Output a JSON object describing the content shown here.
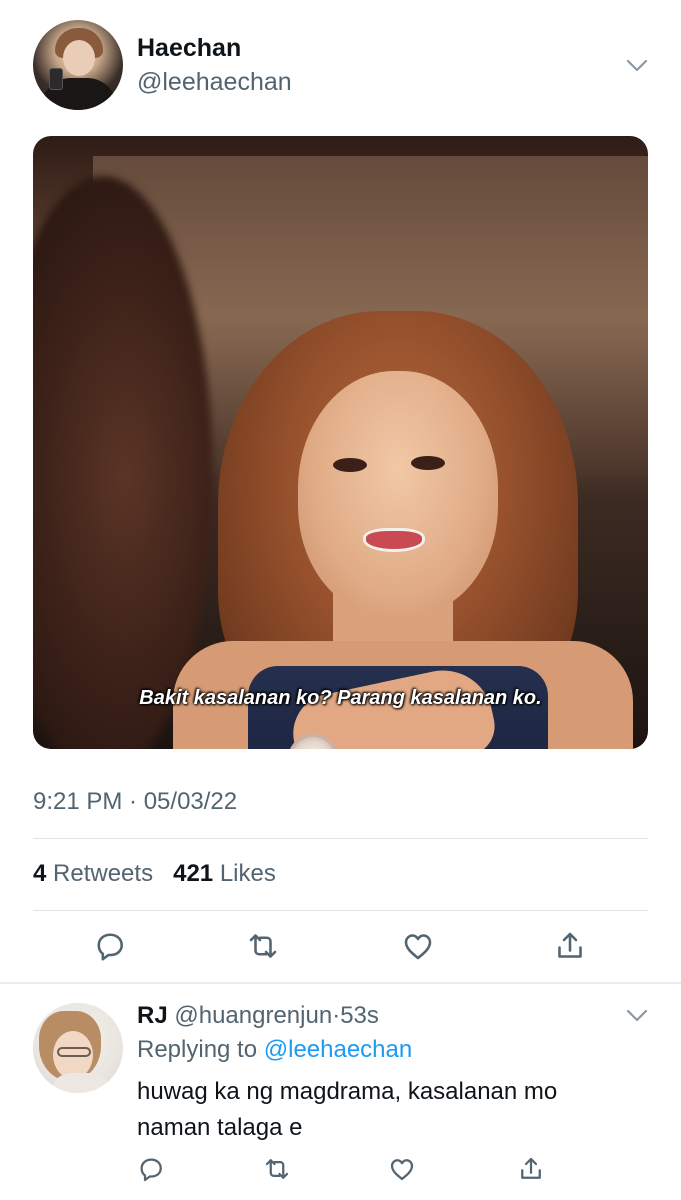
{
  "tweet": {
    "author_name": "Haechan",
    "author_handle": "@leehaechan",
    "media_caption": "Bakit kasalanan ko? Parang kasalanan ko.",
    "timestamp": "9:21 PM · 05/03/22",
    "retweets_count": "4",
    "retweets_label": "Retweets",
    "likes_count": "421",
    "likes_label": "Likes",
    "actions": {
      "reply": "reply-icon",
      "retweet": "retweet-icon",
      "like": "heart-icon",
      "share": "share-icon"
    }
  },
  "reply": {
    "author_name": "RJ",
    "author_handle": "@huangrenjun",
    "separator": "·",
    "time": "53s",
    "replying_to_label": "Replying to",
    "replying_to_handle": "@leehaechan",
    "text": "huwag ka ng magdrama, kasalanan mo naman talaga e"
  },
  "colors": {
    "text_primary": "#0f1419",
    "text_secondary": "#536471",
    "mention_blue": "#1d9bf0",
    "divider": "#dfe3e6"
  }
}
